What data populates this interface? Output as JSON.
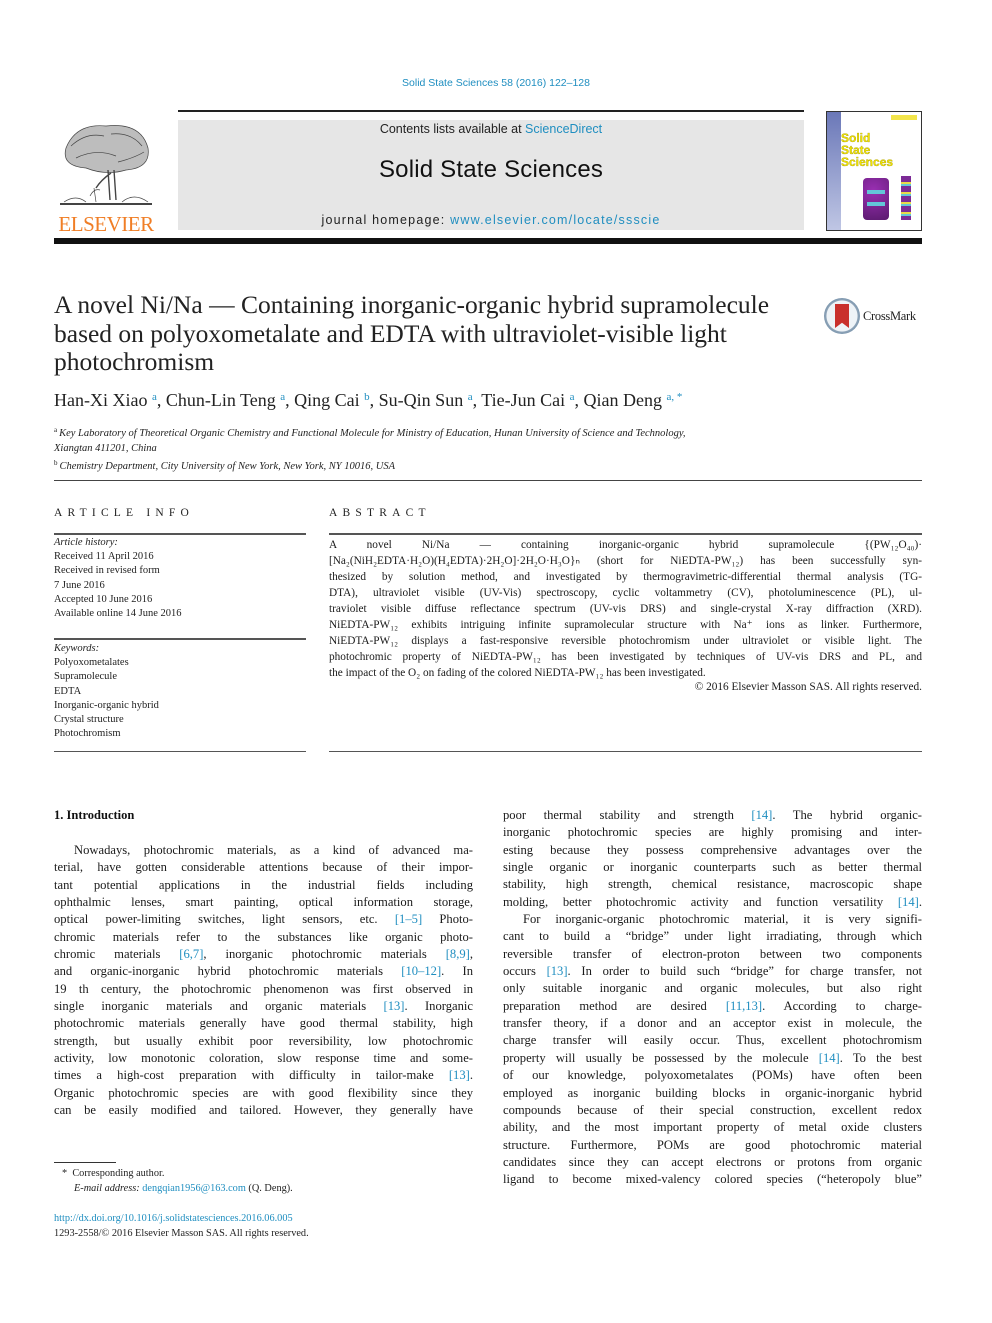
{
  "header": {
    "journal_ref": "Solid State Sciences 58 (2016) 122–128",
    "contents_prefix": "Contents lists available at ",
    "contents_link": "ScienceDirect",
    "journal_title": "Solid State Sciences",
    "homepage_prefix": "journal homepage: ",
    "homepage_link": "www.elsevier.com/locate/ssscie",
    "publisher_logo": "ELSEVIER",
    "cover_title_lines": [
      "Solid",
      "State",
      "Sciences"
    ],
    "crossmark_label": "CrossMark",
    "colors": {
      "link": "#1f8ec0",
      "elsevier_orange": "#f07e26",
      "journal_box_bg": "#e6e6e6"
    }
  },
  "article": {
    "title": "A novel Ni/Na — Containing inorganic-organic hybrid supramolecule based on polyoxometalate and EDTA with ultraviolet-visible light photochromism",
    "authors": [
      {
        "name": "Han-Xi Xiao",
        "aff": "a"
      },
      {
        "name": "Chun-Lin Teng",
        "aff": "a"
      },
      {
        "name": "Qing Cai",
        "aff": "b"
      },
      {
        "name": "Su-Qin Sun",
        "aff": "a"
      },
      {
        "name": "Tie-Jun Cai",
        "aff": "a"
      },
      {
        "name": "Qian Deng",
        "aff": "a, *"
      }
    ],
    "affiliations": [
      {
        "mark": "a",
        "line1": "Key Laboratory of Theoretical Organic Chemistry and Functional Molecule for Ministry of Education, Hunan University of Science and Technology,",
        "line2": "Xiangtan 411201, China"
      },
      {
        "mark": "b",
        "line1": "Chemistry Department, City University of New York, New York, NY 10016, USA"
      }
    ]
  },
  "article_info": {
    "heading": "ARTICLE INFO",
    "history_label": "Article history:",
    "history": [
      "Received 11 April 2016",
      "Received in revised form",
      "7 June 2016",
      "Accepted 10 June 2016",
      "Available online 14 June 2016"
    ],
    "keywords_label": "Keywords:",
    "keywords": [
      "Polyoxometalates",
      "Supramolecule",
      "EDTA",
      "Inorganic-organic hybrid",
      "Crystal structure",
      "Photochromism"
    ]
  },
  "abstract": {
    "heading": "ABSTRACT",
    "lines": [
      "A novel Ni/Na — containing inorganic-organic hybrid supramolecule {(PW₁₂O₄₀)·",
      "[Na₂(NiH₂EDTA·H₂O)(H₄EDTA)·2H₂O]·2H₂O·H₃O}ₙ (short for NiEDTA-PW₁₂) has been successfully syn-",
      "thesized by solution method, and investigated by thermogravimetric-differential thermal analysis (TG-",
      "DTA), ultraviolet visible (UV-Vis) spectroscopy, cyclic voltammetry (CV), photoluminescence (PL), ul-",
      "traviolet visible diffuse reflectance spectrum (UV-vis DRS) and single-crystal X-ray diffraction (XRD).",
      "NiEDTA-PW₁₂ exhibits intriguing infinite supramolecular structure with Na⁺ ions as linker. Furthermore,",
      "NiEDTA-PW₁₂ displays a fast-responsive reversible photochromism under ultraviolet or visible light. The",
      "photochromic property of NiEDTA-PW₁₂ has been investigated by techniques of UV-vis DRS and PL, and",
      "the impact of the O₂ on fading of the colored NiEDTA-PW₁₂ has been investigated."
    ],
    "copyright": "© 2016 Elsevier Masson SAS. All rights reserved."
  },
  "introduction": {
    "heading": "1.  Introduction",
    "left_column": [
      {
        "text": "Nowadays, photochromic materials, as a kind of advanced ma-",
        "indent": true
      },
      {
        "text": "terial, have gotten considerable attentions because of their impor-"
      },
      {
        "text": "tant potential applications in the industrial fields including"
      },
      {
        "text": "ophthalmic lenses, smart painting, optical information storage,"
      },
      {
        "text": "optical power-limiting switches, light sensors, etc. [1–5] Photo-"
      },
      {
        "text": "chromic materials refer to the substances like organic photo-"
      },
      {
        "text": "chromic materials [6,7], inorganic photochromic materials [8,9],"
      },
      {
        "text": "and organic-inorganic hybrid photochromic materials [10–12]. In"
      },
      {
        "text": "19 th century, the photochromic phenomenon was first observed in"
      },
      {
        "text": "single inorganic materials and organic materials [13]. Inorganic"
      },
      {
        "text": "photochromic materials generally have good thermal stability, high"
      },
      {
        "text": "strength, but usually exhibit poor reversibility, low photochromic"
      },
      {
        "text": "activity, low monotonic coloration, slow response time and some-"
      },
      {
        "text": "times a high-cost preparation with difficulty in tailor-make [13]."
      },
      {
        "text": "Organic photochromic species are with good flexibility since they"
      },
      {
        "text": "can be easily modified and tailored. However, they generally have"
      }
    ],
    "right_column": [
      {
        "text": "poor thermal stability and strength [14]. The hybrid organic-"
      },
      {
        "text": "inorganic photochromic species are highly promising and inter-"
      },
      {
        "text": "esting because they possess comprehensive advantages over the"
      },
      {
        "text": "single organic or inorganic counterparts such as better thermal"
      },
      {
        "text": "stability, high strength, chemical resistance, macroscopic shape"
      },
      {
        "text": "molding, better photochromic activity and function versatility [14]."
      },
      {
        "text": "For inorganic-organic photochromic material, it is very signifi-",
        "indent": true
      },
      {
        "text": "cant to build a “bridge” under light irradiating, through which"
      },
      {
        "text": "reversible transfer of electron-proton between two components"
      },
      {
        "text": "occurs [13]. In order to build such “bridge” for charge transfer, not"
      },
      {
        "text": "only suitable inorganic and organic molecules, but also right"
      },
      {
        "text": "preparation method are desired [11,13]. According to charge-"
      },
      {
        "text": "transfer theory, if a donor and an acceptor exist in molecule, the"
      },
      {
        "text": "charge transfer will easily occur. Thus, excellent photochromism"
      },
      {
        "text": "property will usually be possessed by the molecule [14]. To the best"
      },
      {
        "text": "of our knowledge, polyoxometalates (POMs) have often been"
      },
      {
        "text": "employed as inorganic building blocks in organic-inorganic hybrid"
      },
      {
        "text": "compounds because of their special construction, excellent redox"
      },
      {
        "text": "ability, and the most important property of metal oxide clusters"
      },
      {
        "text": "structure. Furthermore, POMs are good photochromic material"
      },
      {
        "text": "candidates since they can accept electrons or protons from organic"
      },
      {
        "text": "ligand to become mixed-valency colored species (“heteropoly blue”"
      }
    ]
  },
  "footnote": {
    "mark": "*",
    "corresponding": "Corresponding author.",
    "email_label": "E-mail address:",
    "email": "dengqian1956@163.com",
    "email_suffix": " (Q. Deng)."
  },
  "doi": {
    "link": "http://dx.doi.org/10.1016/j.solidstatesciences.2016.06.005",
    "issn_line": "1293-2558/© 2016 Elsevier Masson SAS. All rights reserved."
  }
}
